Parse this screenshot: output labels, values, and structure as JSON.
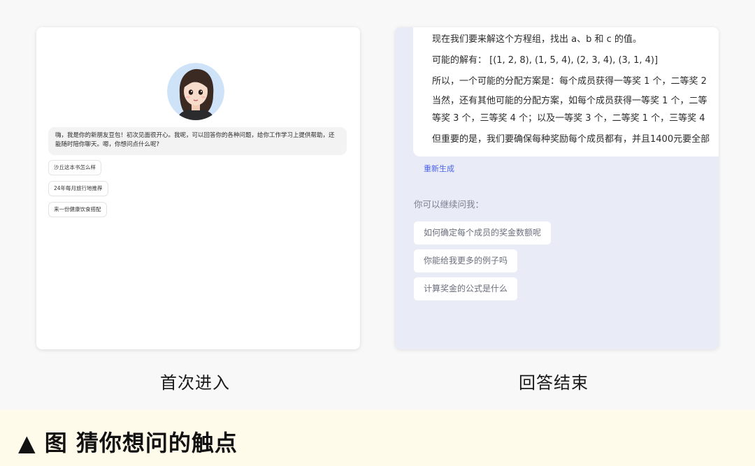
{
  "left_card": {
    "greeting": "嗨，我是你的新朋友豆包！初次见面很开心。我呢，可以回答你的各种问题，给你工作学习上提供帮助，还能随时陪你聊天。嗯，你想问点什么呢?",
    "suggestions": [
      "沙丘这本书怎么样",
      "24年每月旅行地推荐",
      "来一份健康饮食搭配"
    ],
    "caption": "首次进入"
  },
  "right_card": {
    "answer_lines": [
      "现在我们要来解这个方程组，找出 a、b 和 c 的值。",
      "可能的解有： [(1, 2, 8), (1, 5, 4), (2, 3, 4), (3, 1, 4)]",
      "所以，一个可能的分配方案是：每个成员获得一等奖 1 个，二等奖 2",
      "当然，还有其他可能的分配方案，如每个成员获得一等奖 1 个，二等",
      "等奖 3 个，三等奖 4 个；以及一等奖 3 个，二等奖 1 个，三等奖 4",
      "但重要的是，我们要确保每种奖励每个成员都有，并且1400元要全部"
    ],
    "regenerate": "重新生成",
    "follow_title": "你可以继续问我：",
    "follow_ups": [
      "如何确定每个成员的奖金数额呢",
      "你能给我更多的例子吗",
      "计算奖金的公式是什么"
    ],
    "caption": "回答结束"
  },
  "banner": {
    "text": "▲ 图 猜你想问的触点"
  },
  "colors": {
    "accent": "#4b63e8",
    "banner_bg": "#fffbea",
    "right_card_bg": "#e9ecf7"
  }
}
